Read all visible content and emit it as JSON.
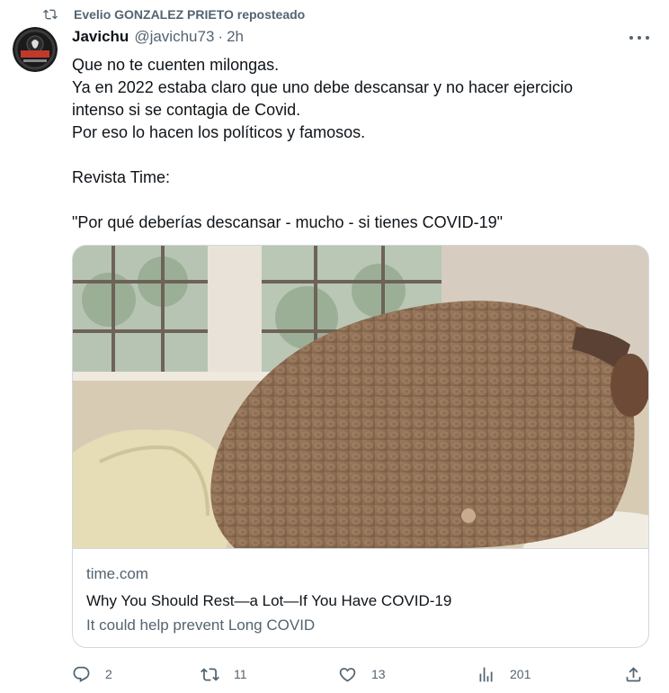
{
  "repost": {
    "text": "Evelio GONZALEZ PRIETO reposteado",
    "icon": "repost-icon"
  },
  "author": {
    "name": "Javichu",
    "handle": "@javichu73",
    "separator": "·",
    "time": "2h",
    "avatar_text": "AL RESPETO"
  },
  "tweet": {
    "lines": [
      "Que no te cuenten milongas.",
      "Ya en 2022 estaba claro que uno debe descansar y no hacer ejercicio",
      "intenso si se contagia de Covid.",
      "Por eso lo hacen los políticos y famosos.",
      "",
      "Revista Time:",
      "",
      "\"Por qué deberías descansar - mucho - si tienes COVID-19\""
    ]
  },
  "card": {
    "domain": "time.com",
    "title": "Why You Should Rest—a Lot—If You Have COVID-19",
    "description": "It could help prevent Long COVID"
  },
  "actions": {
    "replies": "2",
    "reposts": "11",
    "likes": "13",
    "views": "201"
  },
  "colors": {
    "text": "#0f1419",
    "secondary": "#536471",
    "border": "#cfd9de"
  }
}
